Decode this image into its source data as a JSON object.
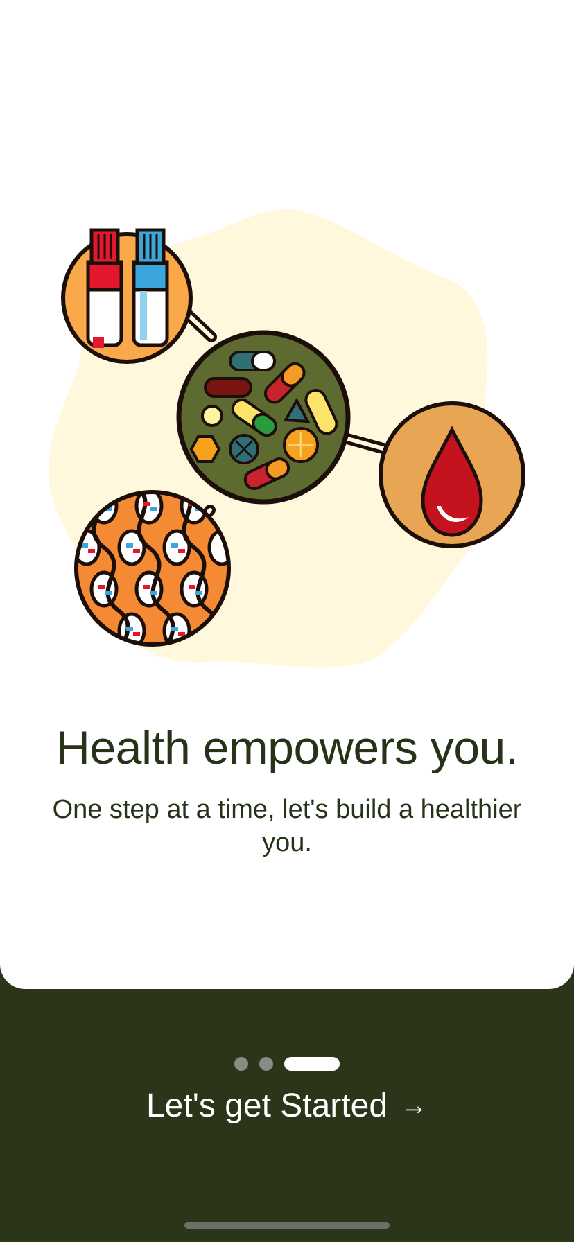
{
  "onboarding": {
    "headline": "Health empowers you.",
    "subtitle": "One step at a time, let's build a healthier you.",
    "cta_label": "Let's get Started",
    "cta_arrow": "→",
    "pagination": {
      "pages": 3,
      "current": 3
    }
  },
  "illustration": {
    "icons": [
      "test-tubes-icon",
      "pills-icon",
      "blood-drop-icon",
      "dna-pattern-icon"
    ],
    "colors": {
      "blob": "#fff8dc",
      "orange": "#f9a84a",
      "green": "#5d6b31",
      "tan": "#e8a553",
      "dna": "#f58a35",
      "outline": "#1c0f0a"
    }
  },
  "colors": {
    "background_dark": "#2a351a",
    "text_dark": "#263318"
  }
}
